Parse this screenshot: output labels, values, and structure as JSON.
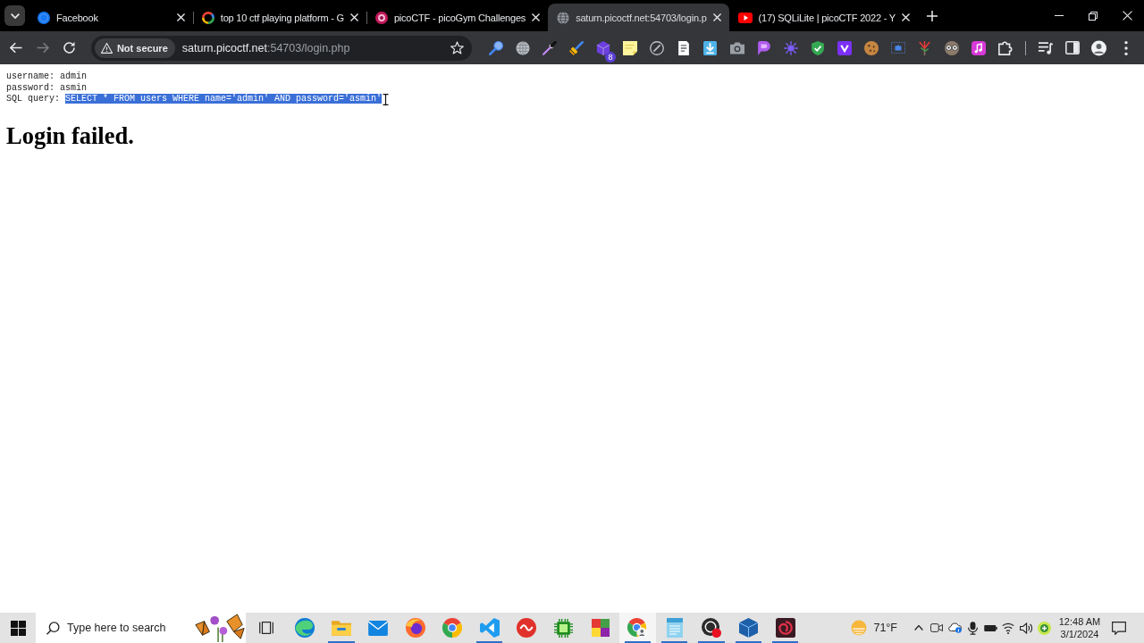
{
  "tabs": [
    {
      "title": "Facebook",
      "selected": false
    },
    {
      "title": "top 10 ctf playing platform - G",
      "selected": false
    },
    {
      "title": "picoCTF - picoGym Challenges",
      "selected": false
    },
    {
      "title": "saturn.picoctf.net:54703/login.p",
      "selected": true
    },
    {
      "title": "(17) SQLiLite | picoCTF 2022 - Y",
      "selected": false
    }
  ],
  "toolbar": {
    "back": {
      "disabled": false
    },
    "forward": {
      "disabled": true
    },
    "security_label": "Not secure",
    "url_host": "saturn.picoctf.net",
    "url_rest": ":54703/login.php",
    "extension_badge": "8"
  },
  "page": {
    "lines": [
      {
        "label": "username:",
        "value": "admin",
        "selected": false
      },
      {
        "label": "password:",
        "value": "asmin",
        "selected": false
      },
      {
        "label": "SQL query:",
        "value": "SELECT * FROM users WHERE name='admin' AND password='asmin'",
        "selected": true
      }
    ],
    "heading": "Login failed."
  },
  "taskbar": {
    "search": {
      "placeholder": "Type here to search"
    },
    "apps": [
      {
        "running": false,
        "selected": false
      },
      {
        "running": true,
        "selected": false
      },
      {
        "running": false,
        "selected": false
      },
      {
        "running": false,
        "selected": false
      },
      {
        "running": false,
        "selected": false
      },
      {
        "running": true,
        "selected": false
      },
      {
        "running": false,
        "selected": false
      },
      {
        "running": false,
        "selected": false
      },
      {
        "running": false,
        "selected": false
      },
      {
        "running": true,
        "selected": true
      },
      {
        "running": true,
        "selected": false
      },
      {
        "running": true,
        "selected": false
      },
      {
        "running": true,
        "selected": false
      },
      {
        "running": true,
        "selected": false
      }
    ],
    "weather": "71°F",
    "time": "12:48 AM",
    "date": "3/1/2024"
  }
}
